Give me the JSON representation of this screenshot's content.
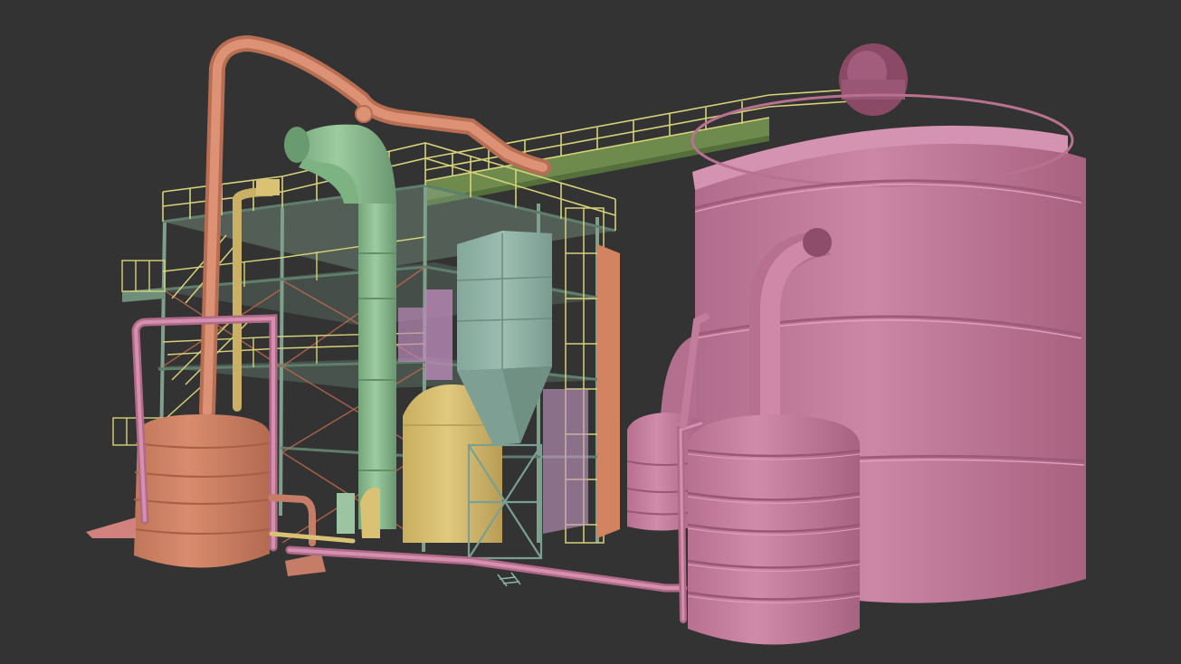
{
  "scene": {
    "background": "#333333",
    "colors": {
      "structure_frame": "#7fa08c",
      "structure_frame_dark": "#5f7f6c",
      "railing": "#d6d27a",
      "green_column": "#8fbf93",
      "green_column_shade": "#6f9f74",
      "orange_pipe": "#d98a6c",
      "orange_tank": "#cf8466",
      "yellow_tank": "#d9c274",
      "hopper": "#8fb3a6",
      "pink_tank": "#c27c9c",
      "pink_tank_dark": "#a6607f",
      "pink_pipe": "#d08aa6",
      "walkway": "#6e8a4c"
    },
    "objects": [
      "steel-frame-structure",
      "green-distillation-column",
      "orange-overhead-pipe",
      "orange-storage-tank",
      "yellow-vessel",
      "dust-collector-hopper",
      "elevated-walkway",
      "large-pink-tank",
      "small-pink-tank-front",
      "small-pink-tank-rear",
      "pink-ground-pipeline"
    ]
  }
}
